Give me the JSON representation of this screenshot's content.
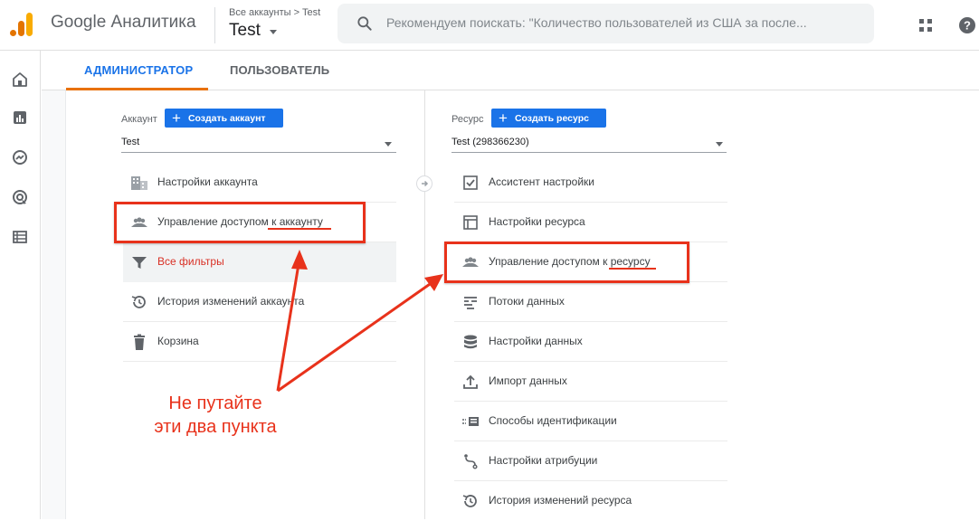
{
  "app": {
    "name": "Google Аналитика",
    "breadcrumb": "Все аккаунты > Test",
    "account_title": "Test"
  },
  "search": {
    "placeholder": "Рекомендуем поискать: \"Количество пользователей из США за после..."
  },
  "tabs": [
    {
      "label": "АДМИНИСТРАТОР",
      "active": true
    },
    {
      "label": "ПОЛЬЗОВАТЕЛЬ",
      "active": false
    }
  ],
  "left_nav": [
    "home-icon",
    "reports-icon",
    "explore-icon",
    "advertising-icon",
    "configure-icon"
  ],
  "account_column": {
    "label": "Аккаунт",
    "create_button": "Создать аккаунт",
    "selected": "Test",
    "items": [
      {
        "icon": "building-icon",
        "label": "Настройки аккаунта"
      },
      {
        "icon": "people-icon",
        "label": "Управление доступом к аккаунту"
      },
      {
        "icon": "filter-icon",
        "label": "Все фильтры",
        "highlight": true
      },
      {
        "icon": "history-icon",
        "label": "История изменений аккаунта"
      },
      {
        "icon": "trash-icon",
        "label": "Корзина"
      }
    ]
  },
  "property_column": {
    "label": "Ресурс",
    "create_button": "Создать ресурс",
    "selected": "Test (298366230)",
    "items": [
      {
        "icon": "checklist-icon",
        "label": "Ассистент настройки"
      },
      {
        "icon": "window-icon",
        "label": "Настройки ресурса"
      },
      {
        "icon": "people-icon",
        "label": "Управление доступом к ресурсу"
      },
      {
        "icon": "data-streams-icon",
        "label": "Потоки данных"
      },
      {
        "icon": "database-icon",
        "label": "Настройки данных"
      },
      {
        "icon": "upload-icon",
        "label": "Импорт данных"
      },
      {
        "icon": "identity-icon",
        "label": "Способы идентификации"
      },
      {
        "icon": "attribution-icon",
        "label": "Настройки атрибуции"
      },
      {
        "icon": "history-icon",
        "label": "История изменений ресурса"
      }
    ]
  },
  "annotation": {
    "line1": "Не путайте",
    "line2": "эти два пункта",
    "color": "#e8321b"
  },
  "colors": {
    "accent": "#1a73e8",
    "tab_indicator": "#e8710a",
    "filter_red": "#d93025"
  }
}
